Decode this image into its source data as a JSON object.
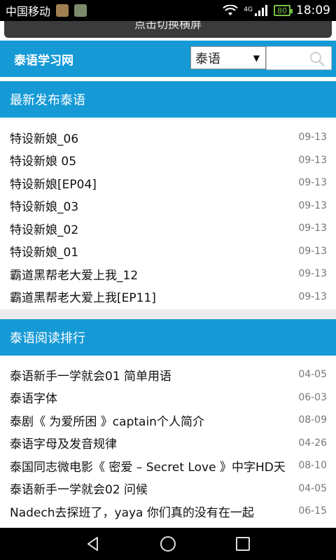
{
  "status_bar": {
    "carrier": "中国移动",
    "network": "4G",
    "battery": "80",
    "time": "18:09"
  },
  "landscape_button": {
    "label": "点击切换横屏"
  },
  "header": {
    "site_title": "泰语学习网",
    "language_select": "泰语",
    "search_placeholder": ""
  },
  "sections": [
    {
      "title": "最新发布泰语",
      "items": [
        {
          "title": "特设新娘_06",
          "date": "09-13"
        },
        {
          "title": "特设新娘 05",
          "date": "09-13"
        },
        {
          "title": "特设新娘[EP04]",
          "date": "09-13"
        },
        {
          "title": "特设新娘_03",
          "date": "09-13"
        },
        {
          "title": "特设新娘_02",
          "date": "09-13"
        },
        {
          "title": "特设新娘_01",
          "date": "09-13"
        },
        {
          "title": "霸道黑帮老大爱上我_12",
          "date": "09-13"
        },
        {
          "title": "霸道黑帮老大爱上我[EP11]",
          "date": "09-13"
        }
      ]
    },
    {
      "title": "泰语阅读排行",
      "items": [
        {
          "title": "泰语新手一学就会01 简单用语",
          "date": "04-05"
        },
        {
          "title": "泰语字体",
          "date": "06-03"
        },
        {
          "title": "泰剧《 为爱所困 》captain个人简介",
          "date": "08-09"
        },
        {
          "title": "泰语字母及发音规律",
          "date": "04-26"
        },
        {
          "title": "泰国同志微电影《 密爱 – Secret Love 》中字HD天",
          "date": "08-10"
        },
        {
          "title": "泰语新手一学就会02 问候",
          "date": "04-05"
        },
        {
          "title": "Nadech去探班了，yaya 你们真的没有在一起",
          "date": "06-15"
        }
      ]
    }
  ],
  "colors": {
    "accent": "#159ad6",
    "status_bar": "#000000",
    "battery": "#7ac043"
  }
}
